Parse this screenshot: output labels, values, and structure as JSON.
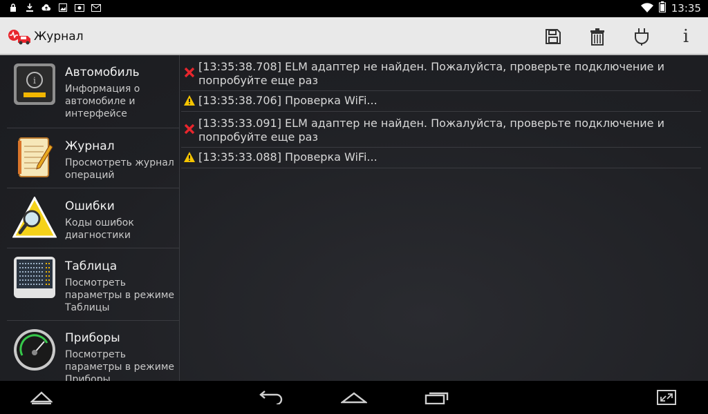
{
  "status_bar": {
    "time": "13:35",
    "left_icons": [
      "lock-icon",
      "download-icon",
      "cloud-upload-icon",
      "image-icon",
      "photo-icon",
      "gmail-icon"
    ],
    "right_icons": [
      "wifi-icon",
      "battery-icon"
    ]
  },
  "action_bar": {
    "title": "Журнал",
    "actions": [
      "save-icon",
      "trash-icon",
      "plug-icon",
      "info-icon"
    ],
    "info_glyph": "i"
  },
  "sidebar": {
    "items": [
      {
        "title": "Автомобиль",
        "desc": "Информация о автомобиле и интерфейсе"
      },
      {
        "title": "Журнал",
        "desc": "Просмотреть журнал операций"
      },
      {
        "title": "Ошибки",
        "desc": "Коды ошибок диагностики"
      },
      {
        "title": "Таблица",
        "desc": "Посмотреть параметры в режиме Таблицы"
      },
      {
        "title": "Приборы",
        "desc": "Посмотреть параметры в режиме Приборы"
      }
    ]
  },
  "log": {
    "entries": [
      {
        "level": "error",
        "text": "[13:35:38.708] ELM адаптер не найден. Пожалуйста, проверьте подключение и попробуйте еще раз"
      },
      {
        "level": "warning",
        "text": "[13:35:38.706] Проверка WiFi..."
      },
      {
        "level": "error",
        "text": "[13:35:33.091] ELM адаптер не найден. Пожалуйста, проверьте подключение и попробуйте еще раз"
      },
      {
        "level": "warning",
        "text": "[13:35:33.088] Проверка WiFi..."
      }
    ]
  },
  "nav_bar": {
    "buttons": [
      "up-icon",
      "back-icon",
      "home-icon",
      "recents-icon",
      "fullscreen-icon"
    ]
  },
  "colors": {
    "error": "#e8262d",
    "warning": "#f5c400",
    "background": "#1f2024",
    "actionbar": "#e9e9e9"
  }
}
